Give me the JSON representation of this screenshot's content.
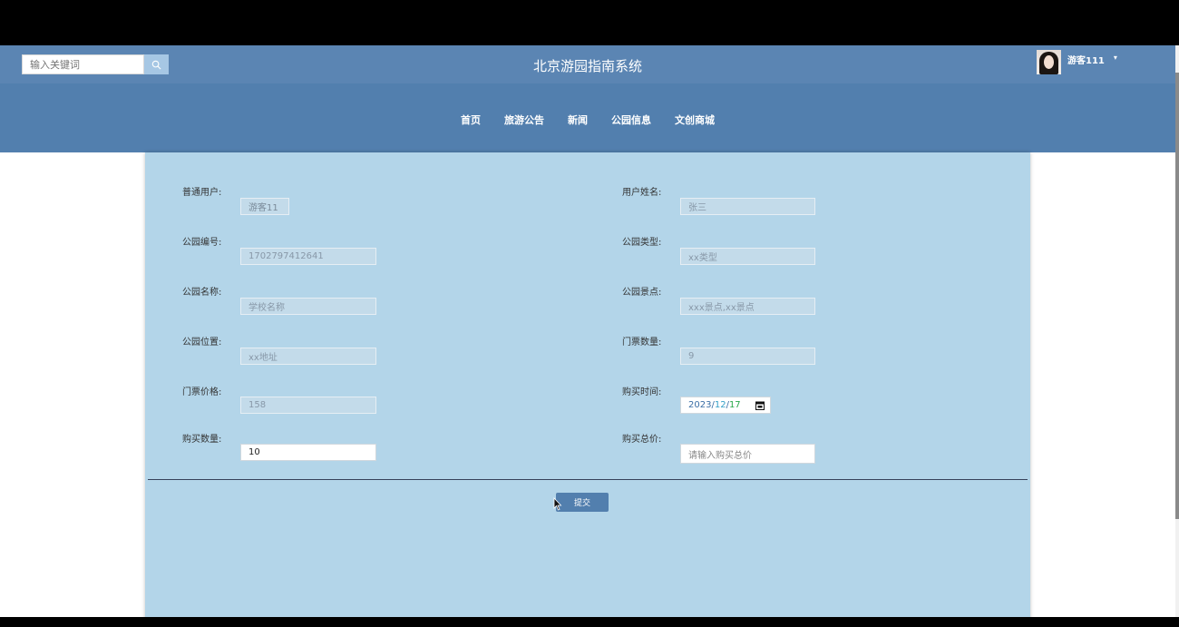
{
  "header": {
    "search_placeholder": "输入关键词",
    "title": "北京游园指南系统",
    "user_name": "游客111",
    "caret": "▾"
  },
  "nav": {
    "items": [
      "首页",
      "旅游公告",
      "新闻",
      "公园信息",
      "文创商城"
    ]
  },
  "form": {
    "user_label": "普通用户:",
    "user_value": "游客11",
    "username_label": "用户姓名:",
    "username_value": "张三",
    "park_no_label": "公园编号:",
    "park_no_value": "1702797412641",
    "park_type_label": "公园类型:",
    "park_type_value": "xx类型",
    "park_name_label": "公园名称:",
    "park_name_value": "学校名称",
    "park_spots_label": "公园景点:",
    "park_spots_value": "xxx景点,xx景点",
    "park_location_label": "公园位置:",
    "park_location_value": "xx地址",
    "ticket_qty_label": "门票数量:",
    "ticket_qty_value": "9",
    "ticket_price_label": "门票价格:",
    "ticket_price_value": "158",
    "buy_time_label": "购买时间:",
    "buy_time_year": "2023",
    "buy_time_sep": "/",
    "buy_time_month": "12",
    "buy_time_day": "17",
    "buy_qty_label": "购买数量:",
    "buy_qty_value": "10",
    "total_label": "购买总价:",
    "total_placeholder": "请输入购买总价",
    "submit_label": "提交"
  },
  "icons": {
    "search": "search-icon",
    "calendar": "calendar-icon",
    "dropdown": "chevron-down-icon"
  },
  "colors": {
    "topbar": "#5b85b3",
    "navbar": "#527fae",
    "panel": "#b3d5e9",
    "button": "#527fae"
  }
}
